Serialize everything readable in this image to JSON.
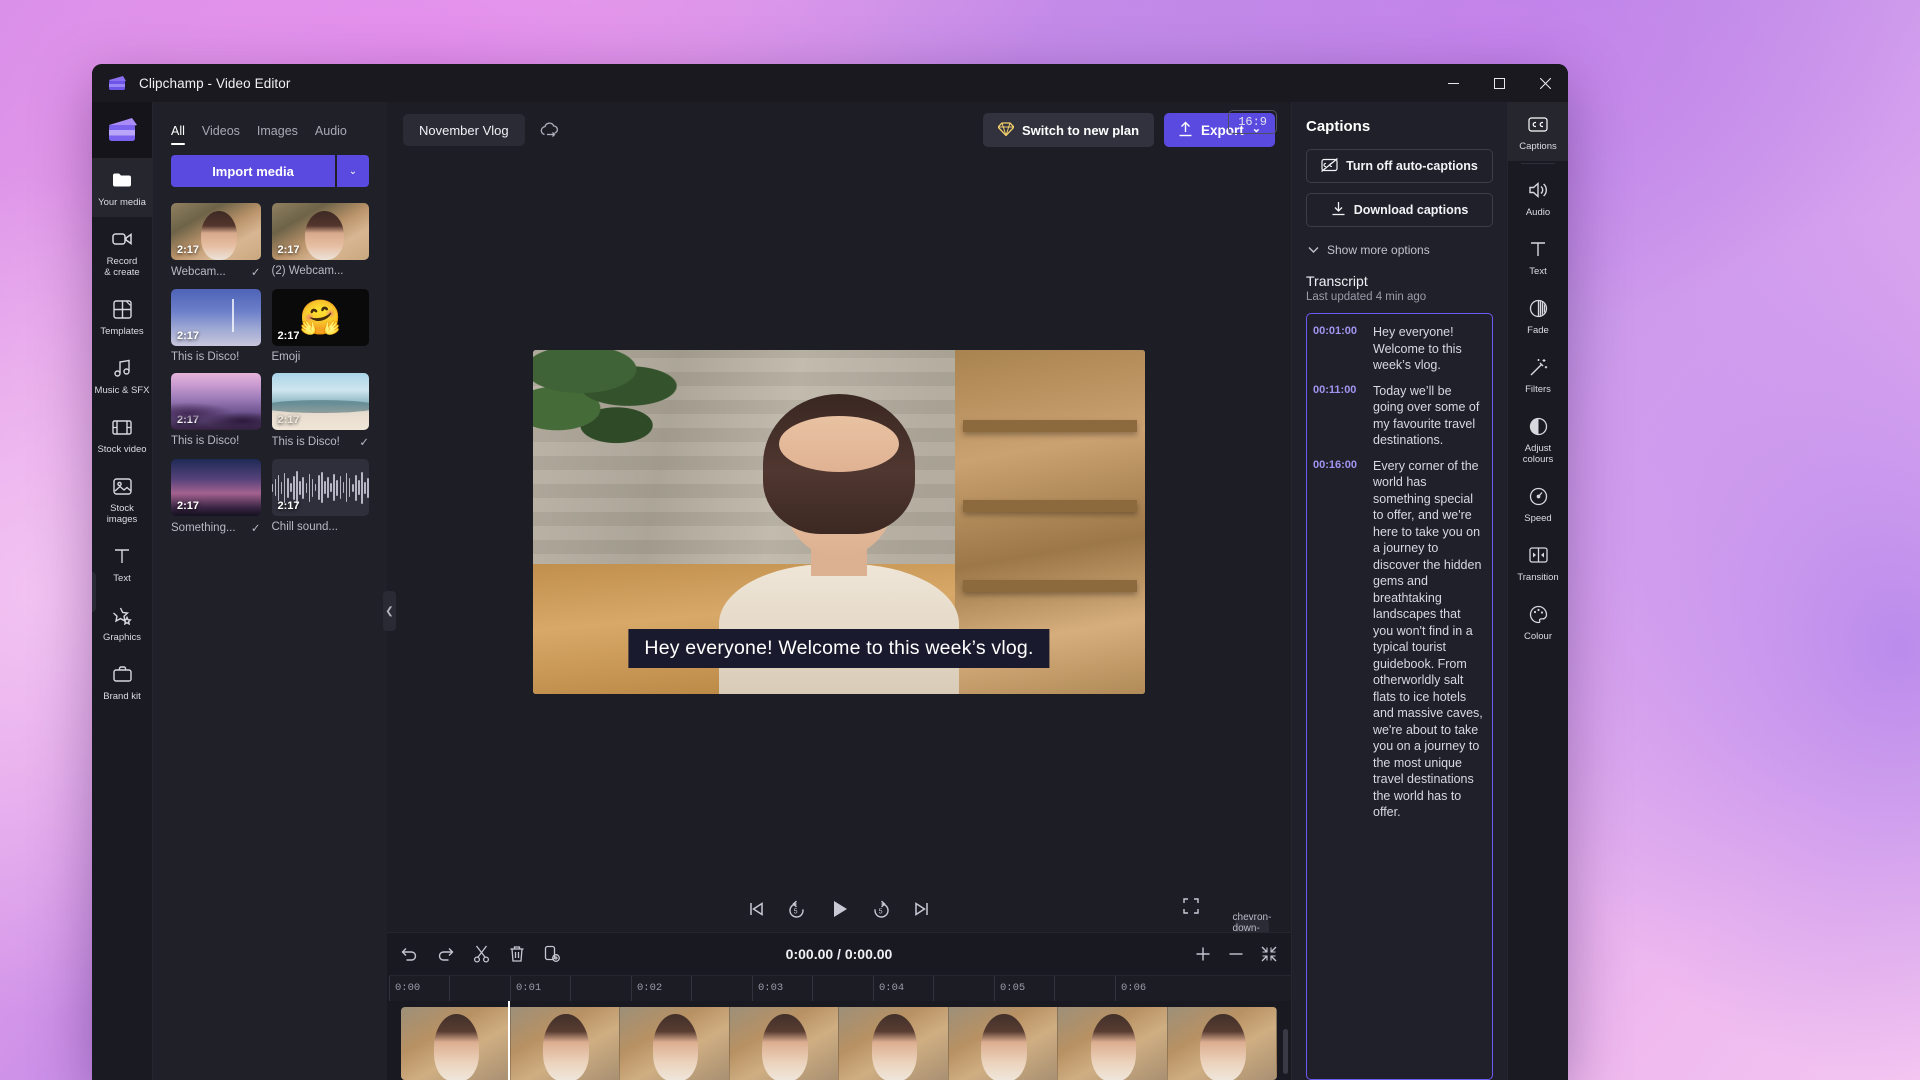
{
  "window": {
    "title": "Clipchamp - Video Editor",
    "controls": {
      "minimize": "—",
      "maximize": "☐",
      "close": "✕"
    }
  },
  "left_rail": {
    "items": [
      {
        "label": "Your media",
        "icon": "folder-icon",
        "active": true
      },
      {
        "label": "Record\n& create",
        "icon": "camera-icon",
        "active": false
      },
      {
        "label": "Templates",
        "icon": "templates-icon",
        "active": false
      },
      {
        "label": "Music & SFX",
        "icon": "music-icon",
        "active": false
      },
      {
        "label": "Stock video",
        "icon": "film-icon",
        "active": false
      },
      {
        "label": "Stock images",
        "icon": "image-icon",
        "active": false
      },
      {
        "label": "Text",
        "icon": "text-icon",
        "active": false
      },
      {
        "label": "Graphics",
        "icon": "graphics-icon",
        "active": false
      },
      {
        "label": "Brand kit",
        "icon": "brandkit-icon",
        "active": false
      }
    ]
  },
  "media_panel": {
    "tabs": [
      {
        "label": "All",
        "active": true
      },
      {
        "label": "Videos",
        "active": false
      },
      {
        "label": "Images",
        "active": false
      },
      {
        "label": "Audio",
        "active": false
      }
    ],
    "import_button": "Import media",
    "import_caret": "⌄",
    "items": [
      {
        "name": "Webcam...",
        "duration": "2:17",
        "checked": true,
        "thumb": "webcam"
      },
      {
        "name": "(2) Webcam...",
        "duration": "2:17",
        "checked": false,
        "thumb": "webcam"
      },
      {
        "name": "This is Disco!",
        "duration": "2:17",
        "checked": false,
        "thumb": "wind"
      },
      {
        "name": "Emoji",
        "duration": "2:17",
        "checked": false,
        "thumb": "emoji"
      },
      {
        "name": "This is Disco!",
        "duration": "2:17",
        "checked": false,
        "thumb": "mount"
      },
      {
        "name": "This is Disco!",
        "duration": "2:17",
        "checked": true,
        "thumb": "sea"
      },
      {
        "name": "Something...",
        "duration": "2:17",
        "checked": true,
        "thumb": "night"
      },
      {
        "name": "Chill sound...",
        "duration": "2:17",
        "checked": false,
        "thumb": "audio"
      }
    ]
  },
  "topbar": {
    "project_name": "November Vlog",
    "cloud_icon": "cloud-sync-icon",
    "plan_button": "Switch to new plan",
    "plan_icon": "diamond-icon",
    "export_button": "Export",
    "export_icon": "upload-icon",
    "export_caret": "⌄"
  },
  "stage": {
    "aspect_ratio": "16:9",
    "caption_text": "Hey everyone! Welcome to this week’s vlog.",
    "player_controls": [
      {
        "name": "skip-to-start-button",
        "icon": "skip-start-icon"
      },
      {
        "name": "rewind-5-button",
        "icon": "rewind-5-icon"
      },
      {
        "name": "play-button",
        "icon": "play-icon"
      },
      {
        "name": "forward-5-button",
        "icon": "forward-5-icon"
      },
      {
        "name": "skip-to-end-button",
        "icon": "skip-end-icon"
      }
    ],
    "fullscreen_icon": "fullscreen-icon",
    "collapse_icon": "chevron-down-icon"
  },
  "timeline": {
    "tools": [
      {
        "name": "undo-button",
        "icon": "undo-icon"
      },
      {
        "name": "redo-button",
        "icon": "redo-icon"
      },
      {
        "name": "split-button",
        "icon": "scissors-icon"
      },
      {
        "name": "delete-button",
        "icon": "trash-icon"
      },
      {
        "name": "duplicate-button",
        "icon": "duplicate-icon"
      }
    ],
    "time_display": "0:00.00 / 0:00.00",
    "zoom_in": "+",
    "zoom_out": "−",
    "fit_icon": "fit-to-screen-icon",
    "ruler_labels": [
      "0:00",
      "0:01",
      "0:02",
      "0:03",
      "0:04",
      "0:05",
      "0:06"
    ]
  },
  "captions_panel": {
    "title": "Captions",
    "turn_off_button": "Turn off auto-captions",
    "turn_off_icon": "captions-off-icon",
    "download_button": "Download captions",
    "download_icon": "download-icon",
    "show_more": "Show more options",
    "show_more_icon": "chevron-down-icon",
    "transcript_title": "Transcript",
    "transcript_subtitle": "Last updated 4 min ago",
    "transcript": [
      {
        "time": "00:01:00",
        "text": "Hey everyone! Welcome to this week’s vlog."
      },
      {
        "time": "00:11:00",
        "text": "Today we’ll be going over some of my favourite travel destinations."
      },
      {
        "time": "00:16:00",
        "text": "Every corner of the world has something special to offer, and we're here to take you on a journey to discover the hidden gems and breathtaking landscapes that you won't find in a typical tourist guidebook. From otherworldly salt flats to ice hotels and massive caves, we're about to take you on a journey to the most unique travel destinations the world has to offer."
      }
    ]
  },
  "right_rail": {
    "items": [
      {
        "label": "Captions",
        "icon": "cc-icon",
        "active": true
      },
      {
        "label": "Audio",
        "icon": "speaker-icon",
        "active": false
      },
      {
        "label": "Text",
        "icon": "text-icon",
        "active": false
      },
      {
        "label": "Fade",
        "icon": "fade-icon",
        "active": false
      },
      {
        "label": "Filters",
        "icon": "magic-wand-icon",
        "active": false
      },
      {
        "label": "Adjust\ncolours",
        "icon": "contrast-icon",
        "active": false
      },
      {
        "label": "Speed",
        "icon": "speedometer-icon",
        "active": false
      },
      {
        "label": "Transition",
        "icon": "transition-icon",
        "active": false
      },
      {
        "label": "Colour",
        "icon": "palette-icon",
        "active": false
      }
    ]
  },
  "colors": {
    "accent": "#5b4ae0",
    "panel": "#20202a",
    "window": "#1d1d26",
    "transcript_border": "#6a5cf0",
    "timestamp": "#9f95f0"
  }
}
